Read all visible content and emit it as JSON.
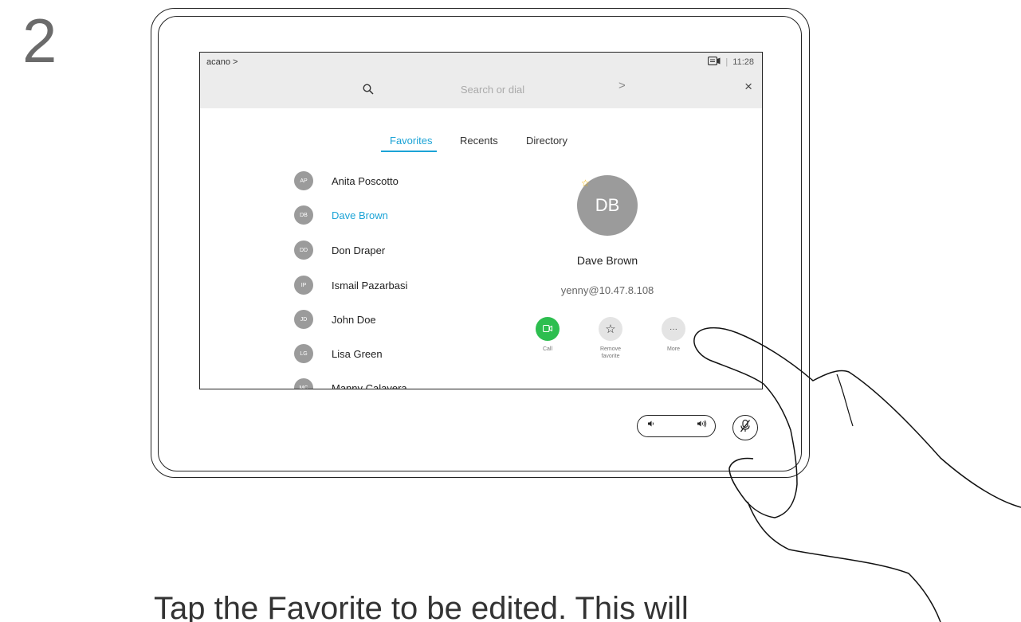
{
  "step": {
    "number": "2"
  },
  "topbar": {
    "brand": "acano >",
    "time": "11:28",
    "search_placeholder": "Search or dial",
    "forward_glyph": ">",
    "close_glyph": "×"
  },
  "tabs": [
    {
      "label": "Favorites",
      "active": true
    },
    {
      "label": "Recents",
      "active": false
    },
    {
      "label": "Directory",
      "active": false
    }
  ],
  "contacts": [
    {
      "initials": "AP",
      "name": "Anita Poscotto",
      "selected": false
    },
    {
      "initials": "DB",
      "name": "Dave Brown",
      "selected": true
    },
    {
      "initials": "DD",
      "name": "Don Draper",
      "selected": false
    },
    {
      "initials": "IP",
      "name": "Ismail Pazarbasi",
      "selected": false
    },
    {
      "initials": "JD",
      "name": "John Doe",
      "selected": false
    },
    {
      "initials": "LG",
      "name": "Lisa Green",
      "selected": false
    },
    {
      "initials": "MC",
      "name": "Manny Calavera",
      "selected": false
    }
  ],
  "detail": {
    "initials": "DB",
    "name": "Dave Brown",
    "address": "yenny@10.47.8.108",
    "actions": {
      "call": "Call",
      "remove_favorite": "Remove favorite",
      "more": "More",
      "more_glyph": "···"
    }
  },
  "colors": {
    "accent": "#1ba3d6",
    "call_green": "#2dbe4f",
    "favorite_star": "#f2b600",
    "avatar_grey": "#9b9b9b",
    "topbar_grey": "#ececec"
  },
  "icons": [
    "search-icon",
    "camera-icon",
    "close-icon",
    "star-icon",
    "video-icon",
    "more-icon",
    "volume-down-icon",
    "volume-up-icon",
    "mute-mic-icon"
  ],
  "instruction": "Tap the Favorite to be edited. This will"
}
